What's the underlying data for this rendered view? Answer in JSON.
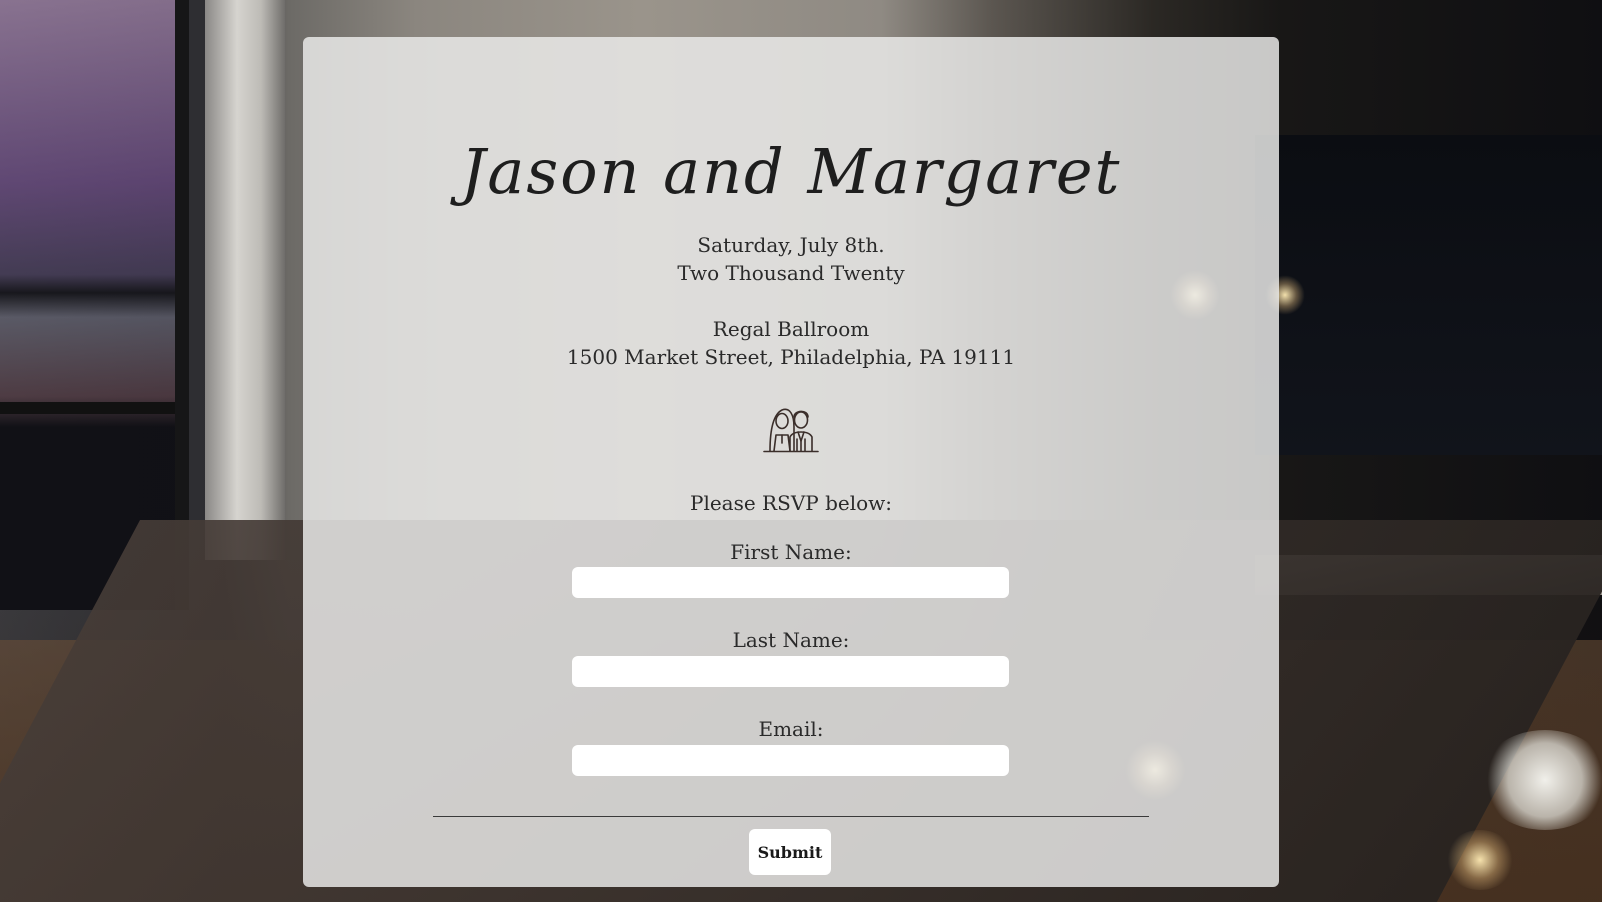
{
  "invitation": {
    "title": "Jason and Margaret",
    "date_line": "Saturday, July 8th.",
    "year_line": "Two Thousand Twenty",
    "venue_name": "Regal Ballroom",
    "venue_address": "1500 Market Street, Philadelphia, PA 19111",
    "icon": "bride-and-groom-icon"
  },
  "rsvp": {
    "prompt": "Please RSVP below:",
    "first_name_label": "First Name:",
    "first_name_value": "",
    "last_name_label": "Last Name:",
    "last_name_value": "",
    "email_label": "Email:",
    "email_value": "",
    "submit_label": "Submit"
  },
  "colors": {
    "card_background": "#ebebe9",
    "text": "#2a2a2a",
    "input_background": "#ffffff"
  }
}
